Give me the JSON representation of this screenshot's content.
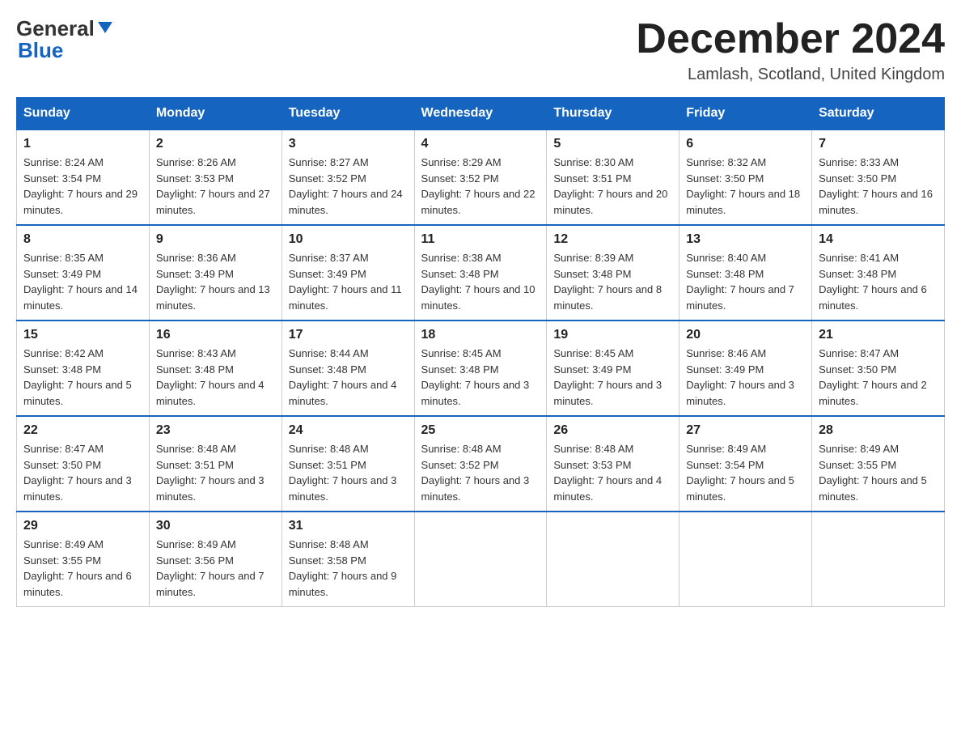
{
  "header": {
    "logo_general": "General",
    "logo_blue": "Blue",
    "month_title": "December 2024",
    "location": "Lamlash, Scotland, United Kingdom"
  },
  "days_of_week": [
    "Sunday",
    "Monday",
    "Tuesday",
    "Wednesday",
    "Thursday",
    "Friday",
    "Saturday"
  ],
  "weeks": [
    [
      {
        "num": "1",
        "sunrise": "8:24 AM",
        "sunset": "3:54 PM",
        "daylight": "7 hours and 29 minutes."
      },
      {
        "num": "2",
        "sunrise": "8:26 AM",
        "sunset": "3:53 PM",
        "daylight": "7 hours and 27 minutes."
      },
      {
        "num": "3",
        "sunrise": "8:27 AM",
        "sunset": "3:52 PM",
        "daylight": "7 hours and 24 minutes."
      },
      {
        "num": "4",
        "sunrise": "8:29 AM",
        "sunset": "3:52 PM",
        "daylight": "7 hours and 22 minutes."
      },
      {
        "num": "5",
        "sunrise": "8:30 AM",
        "sunset": "3:51 PM",
        "daylight": "7 hours and 20 minutes."
      },
      {
        "num": "6",
        "sunrise": "8:32 AM",
        "sunset": "3:50 PM",
        "daylight": "7 hours and 18 minutes."
      },
      {
        "num": "7",
        "sunrise": "8:33 AM",
        "sunset": "3:50 PM",
        "daylight": "7 hours and 16 minutes."
      }
    ],
    [
      {
        "num": "8",
        "sunrise": "8:35 AM",
        "sunset": "3:49 PM",
        "daylight": "7 hours and 14 minutes."
      },
      {
        "num": "9",
        "sunrise": "8:36 AM",
        "sunset": "3:49 PM",
        "daylight": "7 hours and 13 minutes."
      },
      {
        "num": "10",
        "sunrise": "8:37 AM",
        "sunset": "3:49 PM",
        "daylight": "7 hours and 11 minutes."
      },
      {
        "num": "11",
        "sunrise": "8:38 AM",
        "sunset": "3:48 PM",
        "daylight": "7 hours and 10 minutes."
      },
      {
        "num": "12",
        "sunrise": "8:39 AM",
        "sunset": "3:48 PM",
        "daylight": "7 hours and 8 minutes."
      },
      {
        "num": "13",
        "sunrise": "8:40 AM",
        "sunset": "3:48 PM",
        "daylight": "7 hours and 7 minutes."
      },
      {
        "num": "14",
        "sunrise": "8:41 AM",
        "sunset": "3:48 PM",
        "daylight": "7 hours and 6 minutes."
      }
    ],
    [
      {
        "num": "15",
        "sunrise": "8:42 AM",
        "sunset": "3:48 PM",
        "daylight": "7 hours and 5 minutes."
      },
      {
        "num": "16",
        "sunrise": "8:43 AM",
        "sunset": "3:48 PM",
        "daylight": "7 hours and 4 minutes."
      },
      {
        "num": "17",
        "sunrise": "8:44 AM",
        "sunset": "3:48 PM",
        "daylight": "7 hours and 4 minutes."
      },
      {
        "num": "18",
        "sunrise": "8:45 AM",
        "sunset": "3:48 PM",
        "daylight": "7 hours and 3 minutes."
      },
      {
        "num": "19",
        "sunrise": "8:45 AM",
        "sunset": "3:49 PM",
        "daylight": "7 hours and 3 minutes."
      },
      {
        "num": "20",
        "sunrise": "8:46 AM",
        "sunset": "3:49 PM",
        "daylight": "7 hours and 3 minutes."
      },
      {
        "num": "21",
        "sunrise": "8:47 AM",
        "sunset": "3:50 PM",
        "daylight": "7 hours and 2 minutes."
      }
    ],
    [
      {
        "num": "22",
        "sunrise": "8:47 AM",
        "sunset": "3:50 PM",
        "daylight": "7 hours and 3 minutes."
      },
      {
        "num": "23",
        "sunrise": "8:48 AM",
        "sunset": "3:51 PM",
        "daylight": "7 hours and 3 minutes."
      },
      {
        "num": "24",
        "sunrise": "8:48 AM",
        "sunset": "3:51 PM",
        "daylight": "7 hours and 3 minutes."
      },
      {
        "num": "25",
        "sunrise": "8:48 AM",
        "sunset": "3:52 PM",
        "daylight": "7 hours and 3 minutes."
      },
      {
        "num": "26",
        "sunrise": "8:48 AM",
        "sunset": "3:53 PM",
        "daylight": "7 hours and 4 minutes."
      },
      {
        "num": "27",
        "sunrise": "8:49 AM",
        "sunset": "3:54 PM",
        "daylight": "7 hours and 5 minutes."
      },
      {
        "num": "28",
        "sunrise": "8:49 AM",
        "sunset": "3:55 PM",
        "daylight": "7 hours and 5 minutes."
      }
    ],
    [
      {
        "num": "29",
        "sunrise": "8:49 AM",
        "sunset": "3:55 PM",
        "daylight": "7 hours and 6 minutes."
      },
      {
        "num": "30",
        "sunrise": "8:49 AM",
        "sunset": "3:56 PM",
        "daylight": "7 hours and 7 minutes."
      },
      {
        "num": "31",
        "sunrise": "8:48 AM",
        "sunset": "3:58 PM",
        "daylight": "7 hours and 9 minutes."
      },
      null,
      null,
      null,
      null
    ]
  ],
  "labels": {
    "sunrise": "Sunrise:",
    "sunset": "Sunset:",
    "daylight": "Daylight:"
  }
}
